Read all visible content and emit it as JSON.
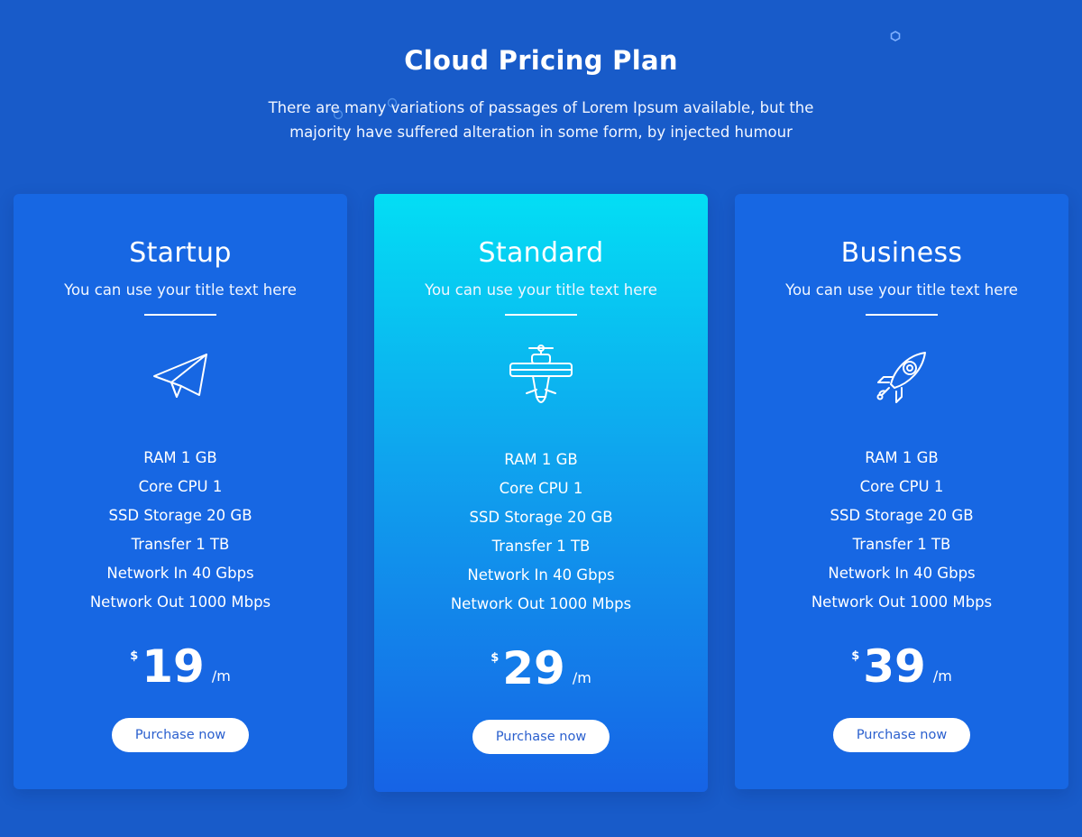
{
  "section": {
    "title": "Cloud Pricing Plan",
    "subtitle_line1": "There are many variations of passages of Lorem Ipsum available, but the",
    "subtitle_line2": "majority have suffered alteration in some form, by injected humour"
  },
  "colors": {
    "background": "#185bc9",
    "card": "#1767e3",
    "featured_gradient_top": "#03def4",
    "featured_gradient_bottom": "#1663e6",
    "button_text": "#2a5fce"
  },
  "plans": [
    {
      "name": "Startup",
      "tagline": "You can use your title text here",
      "icon": "paper-plane-icon",
      "features": [
        "RAM 1 GB",
        "Core CPU 1",
        "SSD Storage 20 GB",
        "Transfer 1 TB",
        "Network In 40 Gbps",
        "Network Out 1000 Mbps"
      ],
      "currency": "$",
      "price": "19",
      "period": "/m",
      "button": "Purchase now",
      "featured": false
    },
    {
      "name": "Standard",
      "tagline": "You can use your title text here",
      "icon": "airplane-icon",
      "features": [
        "RAM 1 GB",
        "Core CPU 1",
        "SSD Storage 20 GB",
        "Transfer 1 TB",
        "Network In 40 Gbps",
        "Network Out 1000 Mbps"
      ],
      "currency": "$",
      "price": "29",
      "period": "/m",
      "button": "Purchase now",
      "featured": true
    },
    {
      "name": "Business",
      "tagline": "You can use your title text here",
      "icon": "rocket-icon",
      "features": [
        "RAM 1 GB",
        "Core CPU 1",
        "SSD Storage 20 GB",
        "Transfer 1 TB",
        "Network In 40 Gbps",
        "Network Out 1000 Mbps"
      ],
      "currency": "$",
      "price": "39",
      "period": "/m",
      "button": "Purchase now",
      "featured": false
    }
  ]
}
